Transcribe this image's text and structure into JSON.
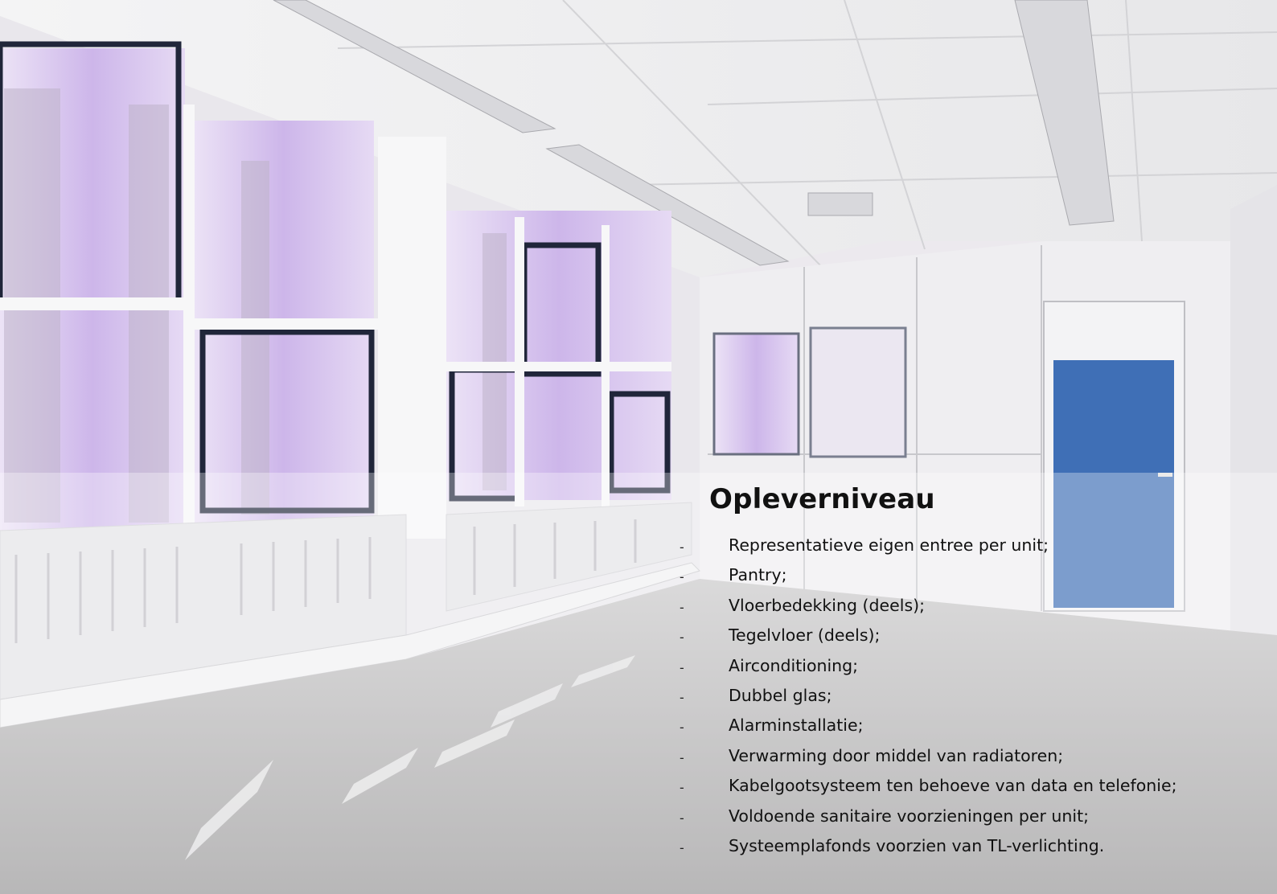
{
  "panel": {
    "title": "Opleverniveau",
    "bullet": "-",
    "items": [
      "Representatieve eigen entree per unit;",
      "Pantry;",
      "Vloerbedekking (deels);",
      "Tegelvloer (deels);",
      "Airconditioning;",
      "Dubbel glas;",
      "Alarminstallatie;",
      "Verwarming door middel van radiatoren;",
      "Kabelgootsysteem ten behoeve van data en telefonie;",
      "Voldoende sanitaire voorzieningen per unit;",
      "Systeemplafonds voorzien van TL-verlichting."
    ]
  },
  "colors": {
    "door": "#3f6fb6",
    "window_frame": "#20263a",
    "window_tint": "#d7c6ee",
    "floor": "#a8a7a8",
    "ceiling": "#f3f3f3"
  }
}
